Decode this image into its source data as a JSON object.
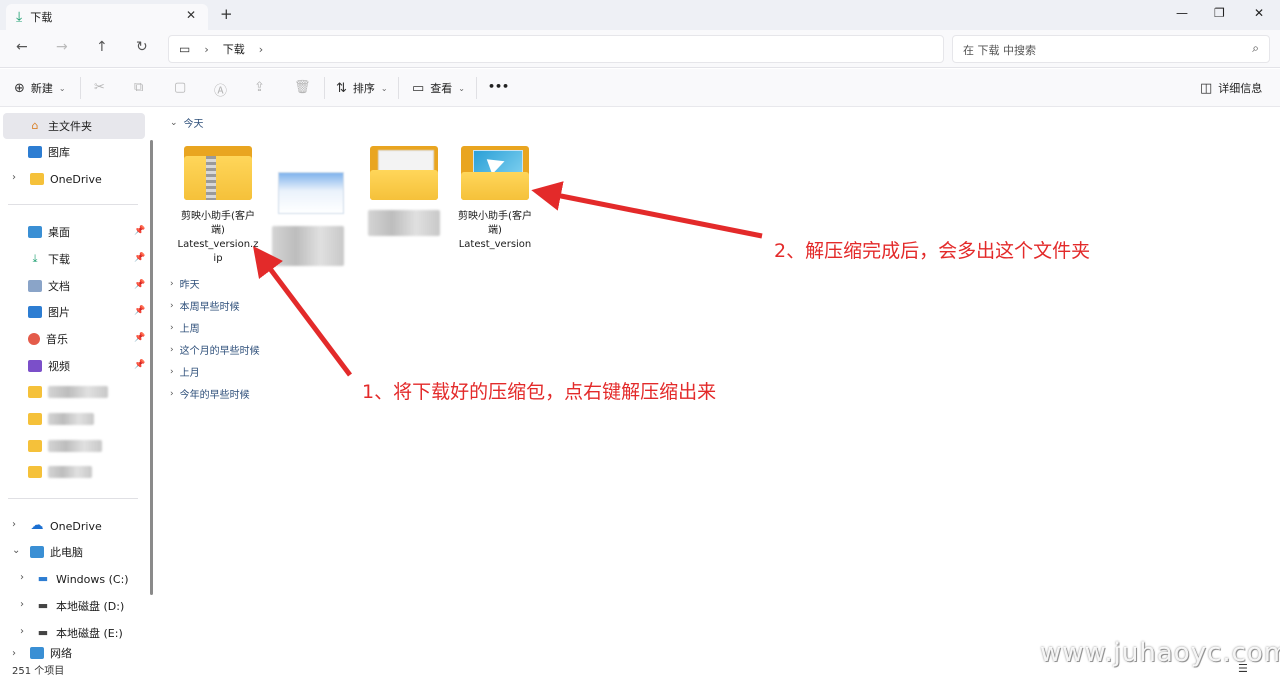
{
  "tab": {
    "title": "下载",
    "close": "✕",
    "new": "+"
  },
  "window": {
    "minimize": "—",
    "restore": "❐",
    "close": "✕"
  },
  "nav": {
    "back": "←",
    "forward": "→",
    "up": "↑",
    "refresh": "↻"
  },
  "address": {
    "crumb": "下载",
    "sep": "›"
  },
  "search": {
    "placeholder": "在 下载 中搜索",
    "icon": "⌕"
  },
  "toolbar": {
    "new_label": "新建",
    "sort_label": "排序",
    "view_label": "查看",
    "more_label": "•••",
    "details_label": "详细信息"
  },
  "sidebar": {
    "home": "主文件夹",
    "gallery": "图库",
    "onedrive": "OneDrive",
    "desktop": "桌面",
    "downloads": "下载",
    "documents": "文档",
    "pictures": "图片",
    "music": "音乐",
    "videos": "视频",
    "onedrive2": "OneDrive",
    "thispc": "此电脑",
    "drive_c": "Windows (C:)",
    "drive_d": "本地磁盘 (D:)",
    "drive_e": "本地磁盘 (E:)",
    "network": "网络"
  },
  "groups": {
    "today": "今天",
    "yesterday": "昨天",
    "earlier_week": "本周早些时候",
    "last_week": "上周",
    "earlier_month": "这个月的早些时候",
    "last_month": "上月",
    "earlier_year": "今年的早些时候"
  },
  "files": {
    "zip_name_1": "剪映小助手(客户",
    "zip_name_2": "端)",
    "zip_name_3": "Latest_version.z",
    "zip_name_4": "ip",
    "folder_name_1": "剪映小助手(客户",
    "folder_name_2": "端)",
    "folder_name_3": "Latest_version"
  },
  "annotations": {
    "step1": "1、将下载好的压缩包，点右键解压缩出来",
    "step2": "2、解压缩完成后，会多出这个文件夹"
  },
  "status": {
    "count": "251 个项目",
    "watermark": "www.juhaoyc.com",
    "view_icon": "☰"
  },
  "colors": {
    "annotation": "#e32a2a",
    "folder": "#f5c13a",
    "group_header": "#2e4f7a"
  }
}
